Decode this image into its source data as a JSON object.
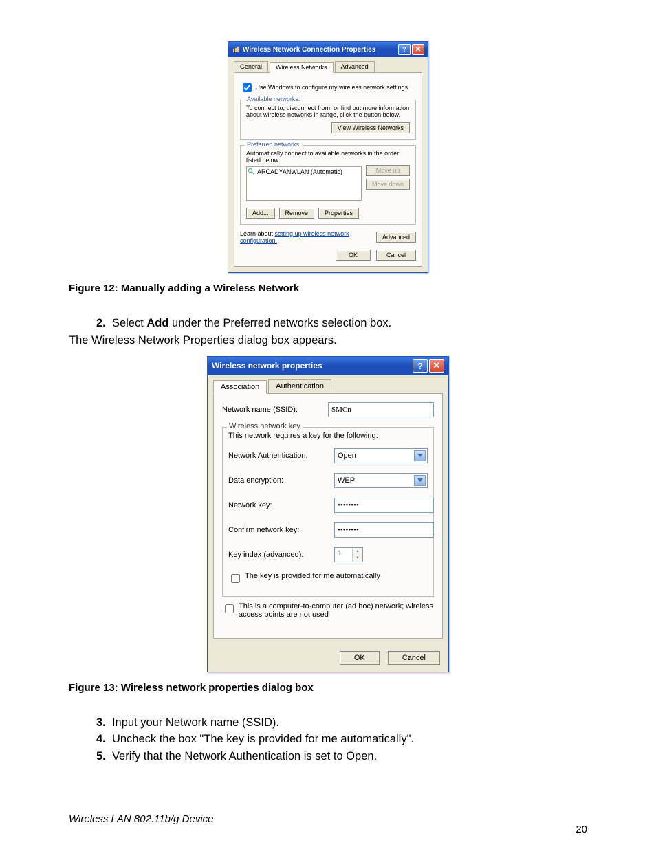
{
  "dialog1": {
    "title": "Wireless Network Connection Properties",
    "tabs": {
      "general": "General",
      "wireless": "Wireless Networks",
      "advanced": "Advanced"
    },
    "checkbox_use_windows": "Use Windows to configure my wireless network settings",
    "available": {
      "legend": "Available networks:",
      "text": "To connect to, disconnect from, or find out more information about wireless networks in range, click the button below.",
      "view_btn": "View Wireless Networks"
    },
    "preferred": {
      "legend": "Preferred networks:",
      "text": "Automatically connect to available networks in the order listed below:",
      "item": "ARCADYANWLAN (Automatic)",
      "move_up": "Move up",
      "move_down": "Move down",
      "add": "Add...",
      "remove": "Remove",
      "properties": "Properties"
    },
    "learn_prefix": "Learn about ",
    "learn_link": "setting up wireless network configuration.",
    "advanced_btn": "Advanced",
    "ok": "OK",
    "cancel": "Cancel"
  },
  "caption1": "Figure 12: Manually adding a Wireless Network",
  "step2": {
    "num": "2.",
    "text_a": "Select ",
    "text_bold": "Add",
    "text_b": " under the Preferred networks selection box.",
    "line2": "The Wireless Network Properties dialog box appears."
  },
  "dialog2": {
    "title": "Wireless network properties",
    "tabs": {
      "assoc": "Association",
      "auth": "Authentication"
    },
    "ssid_label": "Network name (SSID):",
    "ssid_value": "SMCn",
    "key_legend": "Wireless network key",
    "key_text": "This network requires a key for the following:",
    "auth_label": "Network Authentication:",
    "auth_value": "Open",
    "enc_label": "Data encryption:",
    "enc_value": "WEP",
    "netkey_label": "Network key:",
    "netkey_value": "••••••••",
    "confirm_label": "Confirm network key:",
    "confirm_value": "••••••••",
    "keyidx_label": "Key index (advanced):",
    "keyidx_value": "1",
    "auto_check": "The key is provided for me automatically",
    "adhoc_check": "This is a computer-to-computer (ad hoc) network; wireless access points are not used",
    "ok": "OK",
    "cancel": "Cancel"
  },
  "caption2": "Figure 13: Wireless network properties dialog box",
  "steps345": {
    "s3n": "3.",
    "s3": "Input your Network name (SSID).",
    "s4n": "4.",
    "s4": "Uncheck the box \"The key is provided for me automatically\".",
    "s5n": "5.",
    "s5a": "Verify that the Network Authentication is set to ",
    "s5b": "Open",
    "s5c": "."
  },
  "footer_left": "Wireless LAN 802.11b/g Device",
  "footer_right": "20"
}
